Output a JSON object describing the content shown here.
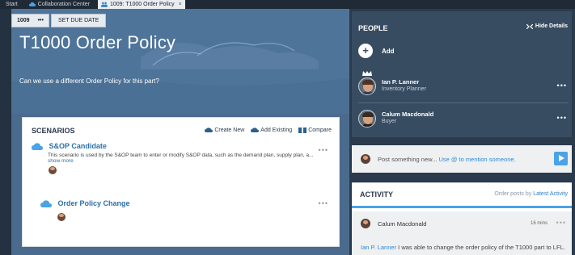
{
  "tabs": [
    {
      "label": "Start"
    },
    {
      "label": "Collaboration Center"
    },
    {
      "label": "1009: T1000 Order Policy",
      "close": "×"
    }
  ],
  "toolbar": {
    "id": "1009",
    "more": "•••",
    "set_due_date": "SET DUE DATE"
  },
  "hero": {
    "title": "T1000 Order Policy",
    "description": "Can we use a different Order Policy for this part?"
  },
  "scenarios": {
    "title": "SCENARIOS",
    "actions": {
      "create_new": "Create New",
      "add_existing": "Add Existing",
      "compare": "Compare"
    },
    "items": [
      {
        "name": "S&OP Candidate",
        "description": "This scenario is used by the S&OP team to enter or modify S&OP data, such as the demand plan, supply plan, a...",
        "show_more": "show more",
        "more": "•••"
      },
      {
        "name": "Order Policy Change",
        "more": "•••"
      }
    ]
  },
  "people": {
    "title": "PEOPLE",
    "hide_details": "Hide Details",
    "add_label": "Add",
    "members": [
      {
        "name": "Ian P. Lanner",
        "role": "Inventory Planner",
        "more": "•••"
      },
      {
        "name": "Calum Macdonald",
        "role": "Buyer",
        "more": "•••"
      }
    ]
  },
  "post": {
    "prefix": "Post something new... ",
    "hint": "Use @ to mention someone."
  },
  "activity": {
    "title": "ACTIVITY",
    "sort_prefix": "Order posts by ",
    "sort_value": "Latest Activity",
    "item": {
      "author": "Calum Macdonald",
      "time": "16 mins",
      "more": "•••",
      "mention": "Ian P. Lanner",
      "message": " I was able to change the order policy of the T1000 part to LFL."
    }
  },
  "colors": {
    "accent": "#4aa3e8",
    "people_bg": "#384c61",
    "hero_bg": "#4f7499",
    "link": "#2e6fa6"
  }
}
